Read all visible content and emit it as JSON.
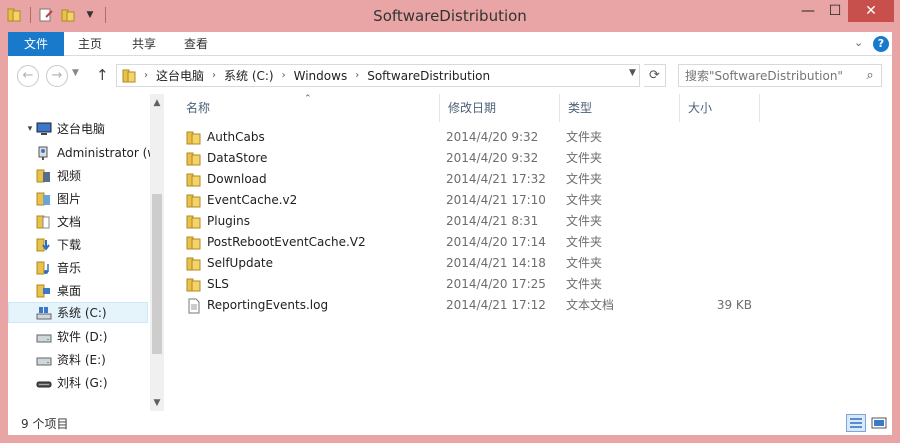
{
  "window": {
    "title": "SoftwareDistribution",
    "minimize": "—",
    "maximize": "☐",
    "close": "✕"
  },
  "ribbon": {
    "tabs": [
      "文件",
      "主页",
      "共享",
      "查看"
    ],
    "help": "?"
  },
  "address": {
    "breadcrumb": [
      "这台电脑",
      "系统 (C:)",
      "Windows",
      "SoftwareDistribution"
    ],
    "search_placeholder": "搜索\"SoftwareDistribution\""
  },
  "nav_pane": {
    "items": [
      {
        "label": "这台电脑",
        "icon": "computer-icon",
        "level": 0
      },
      {
        "label": "Administrator (w",
        "icon": "network-user-icon",
        "level": 1
      },
      {
        "label": "视频",
        "icon": "videos-folder-icon",
        "level": 1
      },
      {
        "label": "图片",
        "icon": "pictures-folder-icon",
        "level": 1
      },
      {
        "label": "文档",
        "icon": "documents-folder-icon",
        "level": 1
      },
      {
        "label": "下载",
        "icon": "downloads-folder-icon",
        "level": 1
      },
      {
        "label": "音乐",
        "icon": "music-folder-icon",
        "level": 1
      },
      {
        "label": "桌面",
        "icon": "desktop-folder-icon",
        "level": 1
      },
      {
        "label": "系统 (C:)",
        "icon": "system-drive-icon",
        "level": 1,
        "selected": true
      },
      {
        "label": "软件 (D:)",
        "icon": "drive-icon",
        "level": 1
      },
      {
        "label": "资料 (E:)",
        "icon": "drive-icon",
        "level": 1
      },
      {
        "label": "刘科 (G:)",
        "icon": "removable-drive-icon",
        "level": 1
      }
    ]
  },
  "columns": {
    "name": "名称",
    "date": "修改日期",
    "type": "类型",
    "size": "大小"
  },
  "files": [
    {
      "name": "AuthCabs",
      "date": "2014/4/20 9:32",
      "type": "文件夹",
      "size": "",
      "kind": "folder"
    },
    {
      "name": "DataStore",
      "date": "2014/4/20 9:32",
      "type": "文件夹",
      "size": "",
      "kind": "folder"
    },
    {
      "name": "Download",
      "date": "2014/4/21 17:32",
      "type": "文件夹",
      "size": "",
      "kind": "folder"
    },
    {
      "name": "EventCache.v2",
      "date": "2014/4/21 17:10",
      "type": "文件夹",
      "size": "",
      "kind": "folder"
    },
    {
      "name": "Plugins",
      "date": "2014/4/21 8:31",
      "type": "文件夹",
      "size": "",
      "kind": "folder"
    },
    {
      "name": "PostRebootEventCache.V2",
      "date": "2014/4/20 17:14",
      "type": "文件夹",
      "size": "",
      "kind": "folder"
    },
    {
      "name": "SelfUpdate",
      "date": "2014/4/21 14:18",
      "type": "文件夹",
      "size": "",
      "kind": "folder"
    },
    {
      "name": "SLS",
      "date": "2014/4/20 17:25",
      "type": "文件夹",
      "size": "",
      "kind": "folder"
    },
    {
      "name": "ReportingEvents.log",
      "date": "2014/4/21 17:12",
      "type": "文本文档",
      "size": "39 KB",
      "kind": "text"
    }
  ],
  "status": {
    "item_count": "9 个项目"
  },
  "colors": {
    "frame": "#e9a5a5",
    "file_tab": "#1979ca",
    "close_button": "#c7504c",
    "selection": "#e5f3fb",
    "folder": "#e8c24a"
  }
}
